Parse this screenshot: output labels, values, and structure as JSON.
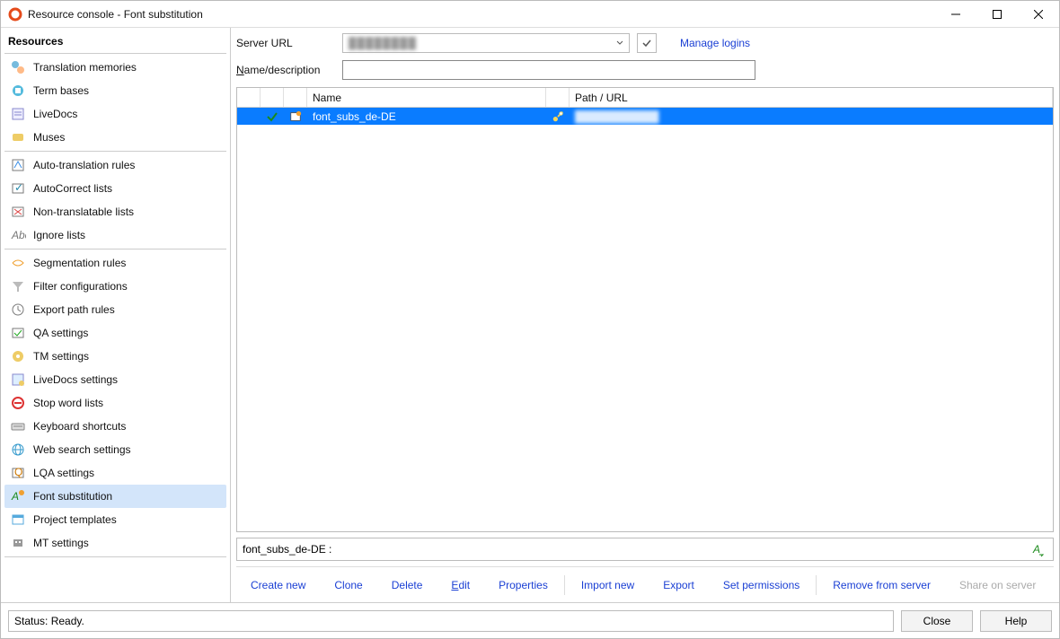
{
  "window": {
    "title": "Resource console - Font substitution"
  },
  "sidebar": {
    "header": "Resources",
    "groups": [
      {
        "items": [
          {
            "key": "tm",
            "label": "Translation memories"
          },
          {
            "key": "tb",
            "label": "Term bases"
          },
          {
            "key": "ld",
            "label": "LiveDocs"
          },
          {
            "key": "muses",
            "label": "Muses"
          }
        ]
      },
      {
        "items": [
          {
            "key": "atr",
            "label": "Auto-translation rules"
          },
          {
            "key": "ac",
            "label": "AutoCorrect lists"
          },
          {
            "key": "ntl",
            "label": "Non-translatable lists"
          },
          {
            "key": "ign",
            "label": "Ignore lists"
          }
        ]
      },
      {
        "items": [
          {
            "key": "seg",
            "label": "Segmentation rules"
          },
          {
            "key": "flt",
            "label": "Filter configurations"
          },
          {
            "key": "exp",
            "label": "Export path rules"
          },
          {
            "key": "qa",
            "label": "QA settings"
          },
          {
            "key": "tms",
            "label": "TM settings"
          },
          {
            "key": "lds",
            "label": "LiveDocs settings"
          },
          {
            "key": "swl",
            "label": "Stop word lists"
          },
          {
            "key": "kb",
            "label": "Keyboard shortcuts"
          },
          {
            "key": "ws",
            "label": "Web search settings"
          },
          {
            "key": "lqa",
            "label": "LQA settings"
          },
          {
            "key": "font",
            "label": "Font substitution",
            "selected": true
          },
          {
            "key": "pt",
            "label": "Project templates"
          },
          {
            "key": "mt",
            "label": "MT settings"
          }
        ]
      }
    ]
  },
  "top": {
    "server_url_label": "Server URL",
    "manage_logins": "Manage logins",
    "filter_label": "Name/description"
  },
  "table": {
    "headers": {
      "name": "Name",
      "path": "Path / URL"
    },
    "rows": [
      {
        "name": "font_subs_de-DE",
        "path": "",
        "selected": true
      }
    ]
  },
  "info": {
    "text": "font_subs_de-DE :"
  },
  "actions": {
    "create": "Create new",
    "clone": "Clone",
    "delete": "Delete",
    "edit": "Edit",
    "properties": "Properties",
    "import": "Import new",
    "export": "Export",
    "permissions": "Set permissions",
    "remove": "Remove from server",
    "share": "Share on server"
  },
  "footer": {
    "status": "Status: Ready.",
    "close": "Close",
    "help": "Help"
  }
}
